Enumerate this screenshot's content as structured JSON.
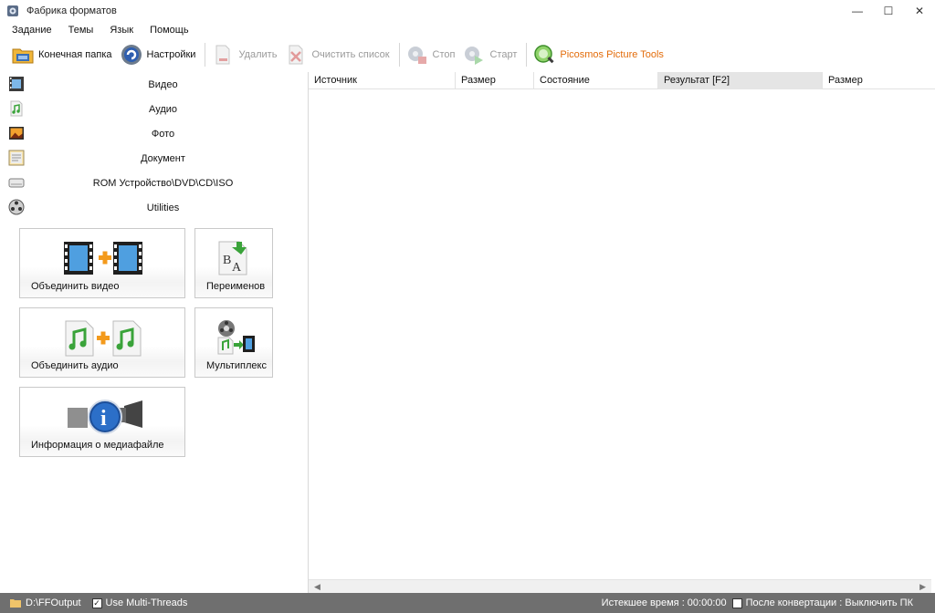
{
  "window": {
    "title": "Фабрика форматов",
    "controls": {
      "minimize": "—",
      "maximize": "☐",
      "close": "✕"
    }
  },
  "menu": [
    "Задание",
    "Темы",
    "Язык",
    "Помощь"
  ],
  "toolbar": {
    "output_folder": "Конечная папка",
    "settings": "Настройки",
    "delete": "Удалить",
    "clear_list": "Очистить список",
    "stop": "Стоп",
    "start": "Старт",
    "picosmos": "Picosmos Picture Tools"
  },
  "categories": [
    {
      "label": "Видео",
      "icon": "video-icon"
    },
    {
      "label": "Аудио",
      "icon": "audio-icon"
    },
    {
      "label": "Фото",
      "icon": "photo-icon"
    },
    {
      "label": "Документ",
      "icon": "document-icon"
    },
    {
      "label": "ROM Устройство\\DVD\\CD\\ISO",
      "icon": "rom-device-icon"
    },
    {
      "label": "Utilities",
      "icon": "utilities-icon"
    }
  ],
  "tiles": {
    "join_video": "Объединить видео",
    "rename": "Переименов",
    "join_audio": "Объединить аудио",
    "multiplex": "Мультиплекс",
    "media_info": "Информация о медиафайле"
  },
  "columns": [
    "Источник",
    "Размер",
    "Состояние",
    "Результат [F2]",
    "Размер"
  ],
  "scroll": {
    "left": "◀",
    "right": "▶"
  },
  "status": {
    "output_path": "D:\\FFOutput",
    "multithreads": "Use Multi-Threads",
    "multithreads_checked": "✓",
    "elapsed": "Истекшее время : 00:00:00",
    "after_conversion": "После конвертации : Выключить ПК"
  },
  "colors": {
    "accent": "#e36c0a",
    "statusbar": "#6f6f6f",
    "active_col": "#e5e5e5"
  }
}
